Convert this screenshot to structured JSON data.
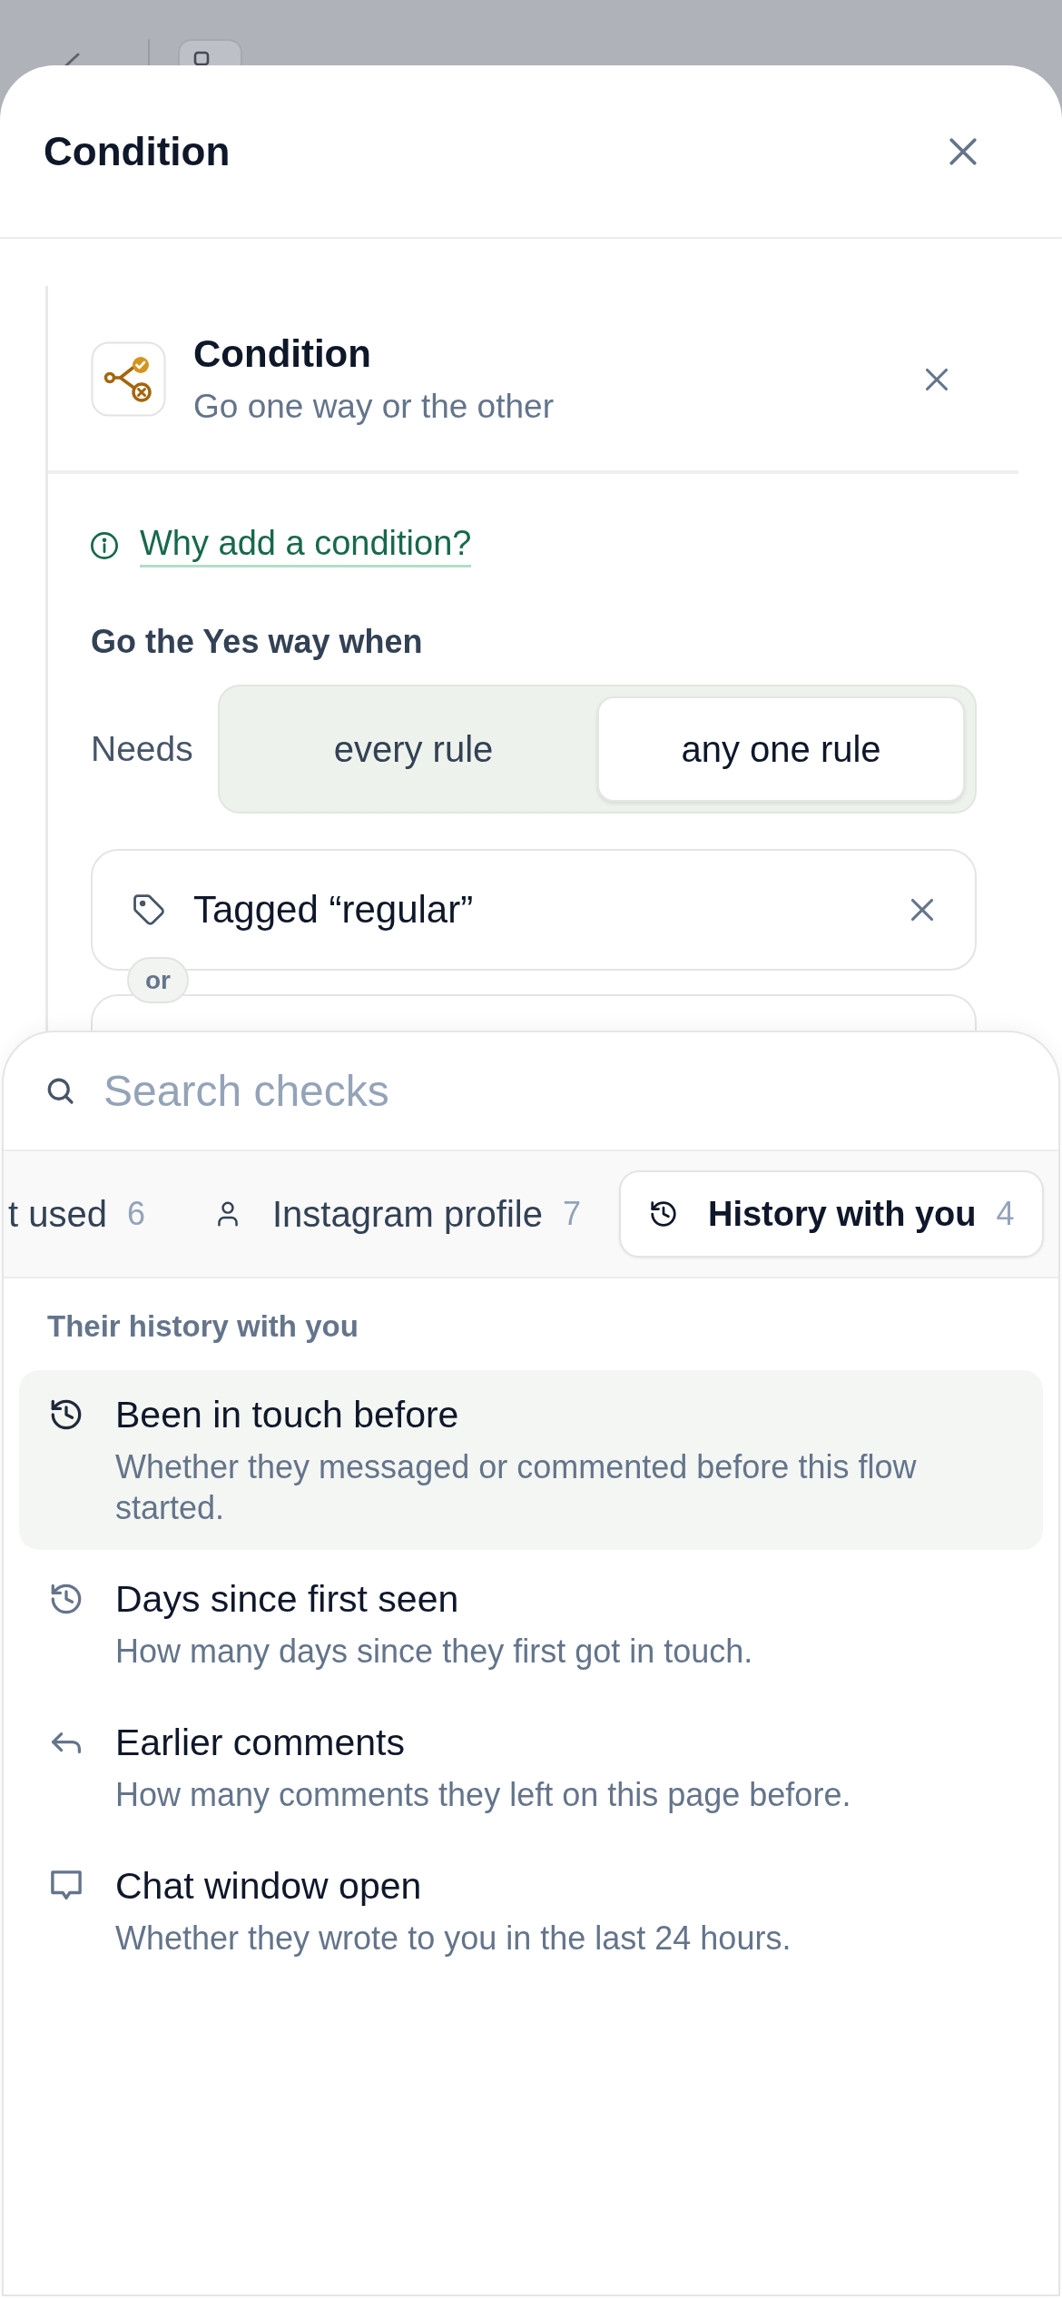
{
  "sheet": {
    "title": "Condition"
  },
  "node": {
    "title": "Condition",
    "subtitle": "Go one way or the other"
  },
  "help_link": {
    "label": "Why add a condition?"
  },
  "match": {
    "heading": "Go the Yes way when",
    "label": "Needs",
    "options": [
      {
        "label": "every rule",
        "selected": false
      },
      {
        "label": "any one rule",
        "selected": true
      }
    ]
  },
  "rules": [
    {
      "label": "Tagged “regular”",
      "joiner": "or"
    }
  ],
  "picker": {
    "search": {
      "placeholder": "Search checks"
    },
    "tabs": [
      {
        "label": "t used",
        "count": "6",
        "selected": false
      },
      {
        "label": "Instagram profile",
        "count": "7",
        "selected": false
      },
      {
        "label": "History with you",
        "count": "4",
        "selected": true
      }
    ],
    "group": {
      "heading": "Their history with you",
      "items": [
        {
          "title": "Been in touch before",
          "description": "Whether they messaged or commented before this flow started.",
          "selected": true
        },
        {
          "title": "Days since first seen",
          "description": "How many days since they first got in touch.",
          "selected": false
        },
        {
          "title": "Earlier comments",
          "description": "How many comments they left on this page before.",
          "selected": false
        },
        {
          "title": "Chat window open",
          "description": "Whether they wrote to you in the last 24 hours.",
          "selected": false
        }
      ]
    }
  }
}
